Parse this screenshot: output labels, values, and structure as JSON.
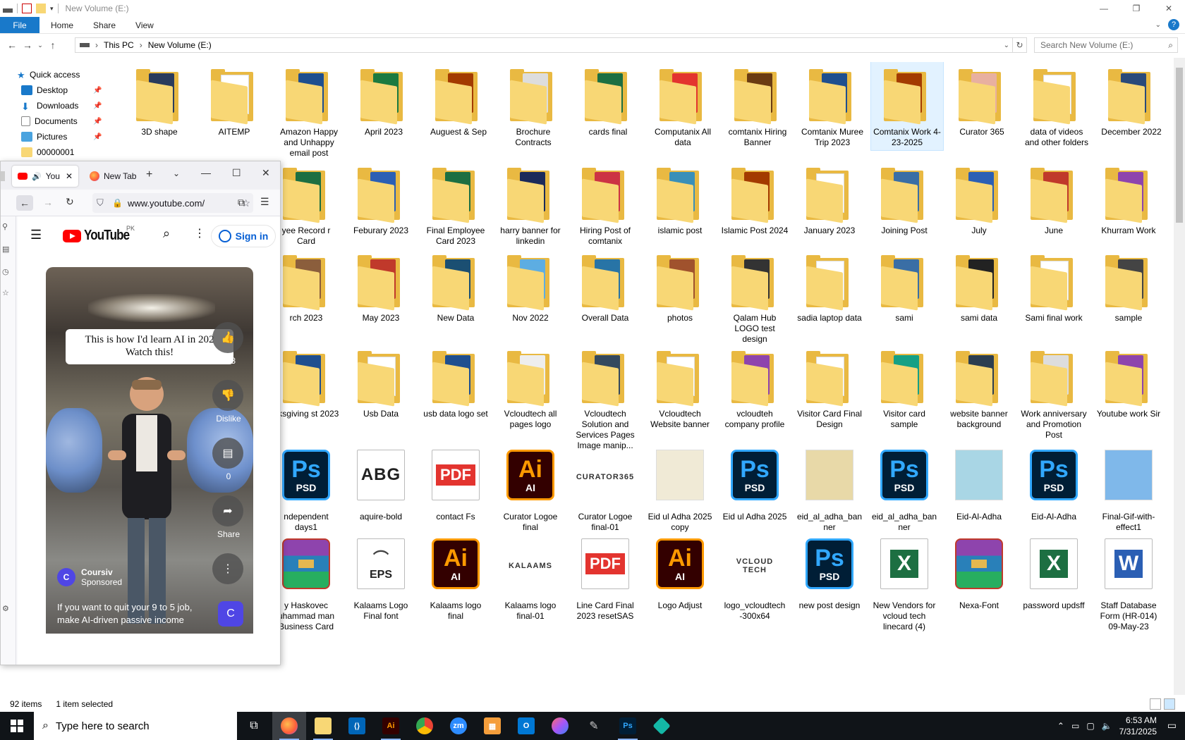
{
  "explorer": {
    "title": "New Volume (E:)",
    "ribbon_tabs": [
      "File",
      "Home",
      "Share",
      "View"
    ],
    "address": {
      "root": "This PC",
      "current": "New Volume (E:)"
    },
    "search_placeholder": "Search New Volume (E:)",
    "nav": [
      {
        "label": "Quick access",
        "pinned": false
      },
      {
        "label": "Desktop",
        "pinned": true
      },
      {
        "label": "Downloads",
        "pinned": true
      },
      {
        "label": "Documents",
        "pinned": true
      },
      {
        "label": "Pictures",
        "pinned": true
      },
      {
        "label": "00000001",
        "pinned": false
      }
    ],
    "status": {
      "items": "92 items",
      "selected": "1 item selected"
    }
  },
  "files": {
    "row1": [
      {
        "label": "3D shape",
        "kind": "folder",
        "tint": "#2a3b5c"
      },
      {
        "label": "AITEMP",
        "kind": "folder",
        "tint": ""
      },
      {
        "label": "Amazon Happy and Unhappy email post",
        "kind": "folder",
        "tint": "#1f4f8f"
      },
      {
        "label": "April 2023",
        "kind": "folder",
        "tint": "#1c7a40"
      },
      {
        "label": "Auguest & Sep",
        "kind": "folder",
        "tint": "#a33b00"
      },
      {
        "label": "Brochure Contracts",
        "kind": "folder",
        "tint": "#dddddd"
      },
      {
        "label": "cards final",
        "kind": "folder",
        "tint": "#1d6f42"
      },
      {
        "label": "Computanix All data",
        "kind": "folder",
        "tint": "#e3342f"
      },
      {
        "label": "comtanix Hiring Banner",
        "kind": "folder",
        "tint": "#6b3c12"
      },
      {
        "label": "Comtanix Muree Trip 2023",
        "kind": "folder",
        "tint": "#1f4f8f"
      },
      {
        "label": "Comtanix Work 4-23-2025",
        "kind": "folder",
        "tint": "#a33b00",
        "selected": true
      },
      {
        "label": "Curator 365",
        "kind": "folder",
        "tint": "#e8b0a0"
      },
      {
        "label": "data of videos and other folders",
        "kind": "folder",
        "tint": ""
      },
      {
        "label": "December 2022",
        "kind": "folder",
        "tint": "#2a4a7a"
      }
    ],
    "row2": [
      {
        "label": "yee Record r Card",
        "kind": "folder",
        "tint": "#1d6f42"
      },
      {
        "label": "Feburary 2023",
        "kind": "folder",
        "tint": "#2b5fb4"
      },
      {
        "label": "Final Employee Card 2023",
        "kind": "folder",
        "tint": "#1d6f42"
      },
      {
        "label": "harry banner for linkedin",
        "kind": "folder",
        "tint": "#1b2a5a"
      },
      {
        "label": "Hiring Post of comtanix",
        "kind": "folder",
        "tint": "#cc3344"
      },
      {
        "label": "islamic post",
        "kind": "folder",
        "tint": "#3a8fb8"
      },
      {
        "label": "Islamic Post 2024",
        "kind": "folder",
        "tint": "#a33b00"
      },
      {
        "label": "January 2023",
        "kind": "folder",
        "tint": ""
      },
      {
        "label": "Joining Post",
        "kind": "folder",
        "tint": "#3a6ea5"
      },
      {
        "label": "July",
        "kind": "folder",
        "tint": "#2b5fb4"
      },
      {
        "label": "June",
        "kind": "folder",
        "tint": "#c0392b"
      },
      {
        "label": "Khurram Work",
        "kind": "folder",
        "tint": "#8e44ad"
      }
    ],
    "row3": [
      {
        "label": "rch 2023",
        "kind": "folder",
        "tint": "#8b5e3c"
      },
      {
        "label": "May 2023",
        "kind": "folder",
        "tint": "#c0392b"
      },
      {
        "label": "New Data",
        "kind": "folder",
        "tint": "#1b4f72"
      },
      {
        "label": "Nov 2022",
        "kind": "folder",
        "tint": "#5dade2"
      },
      {
        "label": "Overall Data",
        "kind": "folder",
        "tint": "#2874a6"
      },
      {
        "label": "photos",
        "kind": "folder",
        "tint": "#a0522d"
      },
      {
        "label": "Qalam Hub LOGO test design",
        "kind": "folder",
        "tint": "#333333"
      },
      {
        "label": "sadia laptop data",
        "kind": "folder",
        "tint": ""
      },
      {
        "label": "sami",
        "kind": "folder",
        "tint": "#3a6ea5"
      },
      {
        "label": "sami data",
        "kind": "folder",
        "tint": "#222222"
      },
      {
        "label": "Sami final work",
        "kind": "folder",
        "tint": ""
      },
      {
        "label": "sample",
        "kind": "folder",
        "tint": "#444444"
      }
    ],
    "row4": [
      {
        "label": "nksgiving st 2023",
        "kind": "folder",
        "tint": "#1f4f8f"
      },
      {
        "label": "Usb Data",
        "kind": "folder",
        "tint": ""
      },
      {
        "label": "usb data logo set",
        "kind": "folder",
        "tint": "#1f4f8f"
      },
      {
        "label": "Vcloudtech all pages logo",
        "kind": "folder",
        "tint": "#eeeeee"
      },
      {
        "label": "Vcloudtech Solution and Services Pages Image manip...",
        "kind": "folder",
        "tint": "#34495e"
      },
      {
        "label": "Vcloudtech Website banner",
        "kind": "folder",
        "tint": ""
      },
      {
        "label": "vcloudteh company profile",
        "kind": "folder",
        "tint": "#8e44ad"
      },
      {
        "label": "Visitor Card Final Design",
        "kind": "folder",
        "tint": ""
      },
      {
        "label": "Visitor card sample",
        "kind": "folder",
        "tint": "#16a085"
      },
      {
        "label": "website banner background",
        "kind": "folder",
        "tint": "#2c3e50"
      },
      {
        "label": "Work anniversary and Promotion Post",
        "kind": "folder",
        "tint": "#dddddd"
      },
      {
        "label": "Youtube work Sir",
        "kind": "folder",
        "tint": "#8e44ad"
      }
    ],
    "row5": [
      {
        "label": "ndependent days1",
        "kind": "ps",
        "tint": "#001e36"
      },
      {
        "label": "aquire-bold",
        "kind": "font",
        "tint": "#ffffff",
        "glyph": "ABG"
      },
      {
        "label": "contact Fs",
        "kind": "pdf",
        "tint": "#e3342f"
      },
      {
        "label": "Curator Logoe final",
        "kind": "ai",
        "tint": "#330000"
      },
      {
        "label": "Curator Logoe final-01",
        "kind": "logo",
        "tint": "#ffffff",
        "glyph": "CURATOR365"
      },
      {
        "label": "Eid ul Adha 2025 copy",
        "kind": "img",
        "tint": "#f0ead6"
      },
      {
        "label": "Eid ul Adha 2025",
        "kind": "ps",
        "tint": "#001e36"
      },
      {
        "label": "eid_al_adha_banner",
        "kind": "img",
        "tint": "#e8d9a8"
      },
      {
        "label": "eid_al_adha_banner",
        "kind": "ps",
        "tint": "#001e36"
      },
      {
        "label": "Eid-Al-Adha",
        "kind": "img",
        "tint": "#a9d6e5"
      },
      {
        "label": "Eid-Al-Adha",
        "kind": "ps",
        "tint": "#001e36"
      },
      {
        "label": "Final-Gif-with-effect1",
        "kind": "img",
        "tint": "#7fb8ea"
      }
    ],
    "row6": [
      {
        "label": "y Haskovec uhammad man Business Card",
        "kind": "rar",
        "tint": "#8e44ad"
      },
      {
        "label": "Kalaams Logo Final font",
        "kind": "eps",
        "tint": "#ffffff"
      },
      {
        "label": "Kalaams logo final",
        "kind": "ai",
        "tint": "#330000"
      },
      {
        "label": "Kalaams logo final-01",
        "kind": "logo",
        "tint": "#ffffff",
        "glyph": "KALAAMS"
      },
      {
        "label": "Line Card Final 2023 resetSAS",
        "kind": "pdf",
        "tint": "#e3342f"
      },
      {
        "label": "Logo Adjust",
        "kind": "ai",
        "tint": "#330000"
      },
      {
        "label": "logo_vcloudtech -300x64",
        "kind": "logo",
        "tint": "#ffffff",
        "glyph": "VCLOUD TECH"
      },
      {
        "label": "new post design",
        "kind": "ps",
        "tint": "#001e36"
      },
      {
        "label": "New Vendors for vcloud tech linecard (4)",
        "kind": "xls",
        "tint": "#1d6f42"
      },
      {
        "label": "Nexa-Font",
        "kind": "rar",
        "tint": "#8e44ad"
      },
      {
        "label": "password updsff",
        "kind": "xls",
        "tint": "#1d6f42"
      },
      {
        "label": "Staff Database Form (HR-014) 09-May-23",
        "kind": "doc",
        "tint": "#2b5fb4"
      }
    ]
  },
  "browser": {
    "tabs": [
      {
        "label": "You"
      },
      {
        "label": "New Tab"
      }
    ],
    "url": "www.youtube.com/",
    "yt": {
      "brand": "YouTube",
      "region": "PK",
      "signin": "Sign in"
    },
    "short": {
      "caption_line1": "This is how I'd learn AI in 202",
      "caption_line2": "Watch this!",
      "likes": "178",
      "dislike": "Dislike",
      "comments": "0",
      "share": "Share",
      "channel": "Coursiv",
      "sponsored": "Sponsored",
      "desc_line1": "If you want to quit your 9 to 5 job,",
      "desc_line2": "make AI-driven passive income"
    }
  },
  "taskbar": {
    "search_placeholder": "Type here to search",
    "time": "6:53 AM",
    "date": "7/31/2025"
  },
  "colors": {
    "accent": "#1979ca",
    "folder": "#f8d775",
    "ps": "#31a8ff",
    "ai": "#ff9a00",
    "pdf": "#e3342f"
  }
}
